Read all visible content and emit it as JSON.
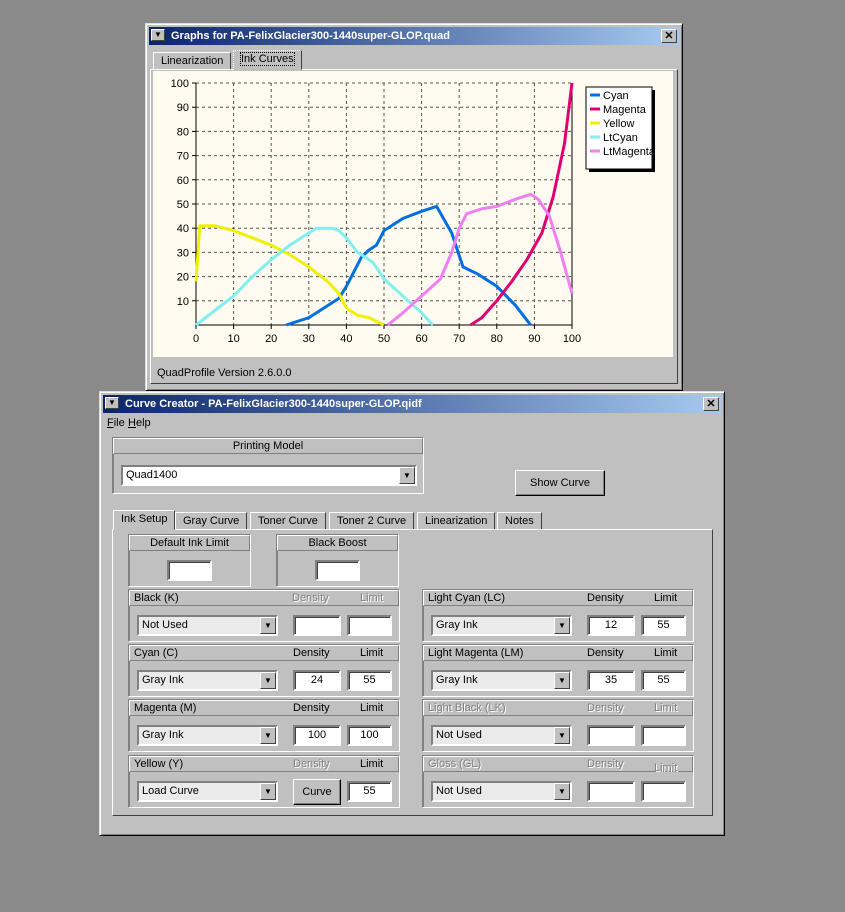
{
  "graphs_window": {
    "title": "Graphs for PA-FelixGlacier300-1440super-GLOP.quad",
    "tabs": [
      {
        "label": "Linearization"
      },
      {
        "label": "Ink Curves"
      }
    ],
    "active_tab": "Ink Curves",
    "version_text": "QuadProfile Version 2.6.0.0"
  },
  "chart_data": {
    "type": "line",
    "title": "",
    "xlabel": "",
    "ylabel": "",
    "xlim": [
      0,
      100
    ],
    "ylim": [
      0,
      100
    ],
    "xticks": [
      "0",
      "10",
      "20",
      "30",
      "40",
      "50",
      "60",
      "70",
      "80",
      "90",
      "100"
    ],
    "yticks": [
      "10",
      "20",
      "30",
      "40",
      "50",
      "60",
      "70",
      "80",
      "90",
      "100"
    ],
    "grid": true,
    "legend_position": "top-right",
    "series": [
      {
        "name": "Cyan",
        "color": "#0070e0",
        "x": [
          24,
          30,
          35,
          38,
          40,
          42,
          44,
          46,
          48,
          50,
          55,
          60,
          64,
          68,
          71,
          75,
          80,
          85,
          89
        ],
        "y": [
          0,
          3,
          8,
          11,
          16,
          22,
          28,
          31,
          33,
          39,
          44,
          47,
          49,
          38,
          24,
          21,
          16,
          8,
          0
        ]
      },
      {
        "name": "Magenta",
        "color": "#e00070",
        "x": [
          73,
          76,
          80,
          84,
          88,
          92,
          95,
          98,
          100
        ],
        "y": [
          0,
          3,
          10,
          18,
          27,
          38,
          53,
          75,
          100
        ]
      },
      {
        "name": "Yellow",
        "color": "#f0f000",
        "x": [
          0,
          1,
          5,
          10,
          15,
          20,
          25,
          30,
          35,
          38,
          40,
          43,
          46,
          50
        ],
        "y": [
          18,
          41,
          41,
          39,
          36,
          33,
          29,
          24,
          18,
          13,
          7,
          4,
          3,
          0
        ]
      },
      {
        "name": "LtCyan",
        "color": "#80f0f0",
        "x": [
          0,
          5,
          10,
          15,
          20,
          25,
          30,
          32,
          36,
          38,
          40,
          43,
          47,
          50,
          55,
          60,
          63
        ],
        "y": [
          0,
          6,
          12,
          20,
          27,
          33,
          38,
          40,
          40,
          39,
          36,
          30,
          26,
          19,
          12,
          5,
          0
        ]
      },
      {
        "name": "LtMagenta",
        "color": "#f080f0",
        "x": [
          51,
          55,
          60,
          65,
          68,
          70,
          72,
          76,
          80,
          85,
          89,
          91,
          94,
          97,
          100
        ],
        "y": [
          0,
          5,
          12,
          19,
          30,
          40,
          46,
          48,
          49,
          52,
          54,
          52,
          45,
          30,
          13
        ]
      }
    ]
  },
  "curve_window": {
    "title": "Curve Creator - PA-FelixGlacier300-1440super-GLOP.qidf",
    "menu": [
      {
        "label": "File",
        "hotkey": "F",
        "rest": "ile"
      },
      {
        "label": "Help",
        "hotkey": "H",
        "rest": "elp"
      }
    ],
    "printing_model": {
      "label": "Printing Model",
      "value": "Quad1400"
    },
    "show_curve_label": "Show Curve",
    "tabs": [
      {
        "label": "Ink Setup"
      },
      {
        "label": "Gray Curve"
      },
      {
        "label": "Toner Curve"
      },
      {
        "label": "Toner 2 Curve"
      },
      {
        "label": "Linearization"
      },
      {
        "label": "Notes"
      }
    ],
    "active_tab": "Ink Setup",
    "default_ink_limit": {
      "label": "Default Ink Limit",
      "value": ""
    },
    "black_boost": {
      "label": "Black Boost",
      "value": ""
    },
    "density_label": "Density",
    "limit_label": "Limit",
    "curve_button_label": "Curve",
    "channels_left": [
      {
        "name": "Black (K)",
        "mode": "Not Used",
        "density": "",
        "limit": "",
        "dim_headers": true
      },
      {
        "name": "Cyan (C)",
        "mode": "Gray Ink",
        "density": "24",
        "limit": "55",
        "dim_headers": false
      },
      {
        "name": "Magenta (M)",
        "mode": "Gray Ink",
        "density": "100",
        "limit": "100",
        "dim_headers": false
      },
      {
        "name": "Yellow (Y)",
        "mode": "Load Curve",
        "density": "",
        "limit": "55",
        "dim_headers": "density"
      }
    ],
    "channels_right": [
      {
        "name": "Light Cyan (LC)",
        "mode": "Gray Ink",
        "density": "12",
        "limit": "55",
        "dim_all": false
      },
      {
        "name": "Light Magenta (LM)",
        "mode": "Gray Ink",
        "density": "35",
        "limit": "55",
        "dim_all": false
      },
      {
        "name": "Light Black (LK)",
        "mode": "Not Used",
        "density": "",
        "limit": "",
        "dim_all": true
      },
      {
        "name": "Gloss (GL)",
        "mode": "Not Used",
        "density": "",
        "limit": "",
        "dim_all": true
      }
    ]
  }
}
